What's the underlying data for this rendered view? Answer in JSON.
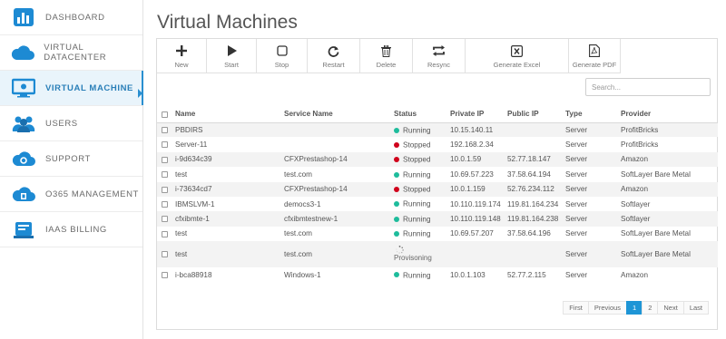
{
  "sidebar": {
    "items": [
      {
        "label": "DASHBOARD",
        "icon": "dashboard-icon"
      },
      {
        "label": "VIRTUAL DATACENTER",
        "icon": "cloud-icon"
      },
      {
        "label": "VIRTUAL MACHINE",
        "icon": "monitor-icon",
        "active": true
      },
      {
        "label": "USERS",
        "icon": "users-icon"
      },
      {
        "label": "SUPPORT",
        "icon": "support-cloud-icon"
      },
      {
        "label": "O365 MANAGEMENT",
        "icon": "office-cloud-icon"
      },
      {
        "label": "IAAS BILLING",
        "icon": "billing-icon"
      }
    ]
  },
  "page": {
    "title": "Virtual Machines"
  },
  "toolbar": [
    {
      "label": "New",
      "icon": "plus-icon"
    },
    {
      "label": "Start",
      "icon": "play-icon"
    },
    {
      "label": "Stop",
      "icon": "stop-icon"
    },
    {
      "label": "Restart",
      "icon": "restart-icon"
    },
    {
      "label": "Delete",
      "icon": "trash-icon"
    },
    {
      "label": "Resync",
      "icon": "resync-icon"
    },
    {
      "label": "Generate Excel",
      "icon": "excel-icon"
    },
    {
      "label": "Generate PDF",
      "icon": "pdf-icon"
    }
  ],
  "search": {
    "placeholder": "Search..."
  },
  "table": {
    "headers": [
      "Name",
      "Service Name",
      "Status",
      "Private IP",
      "Public IP",
      "Type",
      "Provider"
    ],
    "rows": [
      {
        "name": "PBDIRS",
        "service": "",
        "status": "Running",
        "private_ip": "10.15.140.11",
        "public_ip": "",
        "type": "Server",
        "provider": "ProfitBricks"
      },
      {
        "name": "Server-11",
        "service": "",
        "status": "Stopped",
        "private_ip": "192.168.2.34",
        "public_ip": "",
        "type": "Server",
        "provider": "ProfitBricks"
      },
      {
        "name": "i-9d634c39",
        "service": "CFXPrestashop-14",
        "status": "Stopped",
        "private_ip": "10.0.1.59",
        "public_ip": "52.77.18.147",
        "type": "Server",
        "provider": "Amazon"
      },
      {
        "name": "test",
        "service": "test.com",
        "status": "Running",
        "private_ip": "10.69.57.223",
        "public_ip": "37.58.64.194",
        "type": "Server",
        "provider": "SoftLayer Bare Metal"
      },
      {
        "name": "i-73634cd7",
        "service": "CFXPrestashop-14",
        "status": "Stopped",
        "private_ip": "10.0.1.159",
        "public_ip": "52.76.234.112",
        "type": "Server",
        "provider": "Amazon"
      },
      {
        "name": "IBMSLVM-1",
        "service": "democs3-1",
        "status": "Running",
        "private_ip": "10.110.119.174",
        "public_ip": "119.81.164.234",
        "type": "Server",
        "provider": "Softlayer"
      },
      {
        "name": "cfxibmte-1",
        "service": "cfxibmtestnew-1",
        "status": "Running",
        "private_ip": "10.110.119.148",
        "public_ip": "119.81.164.238",
        "type": "Server",
        "provider": "Softlayer"
      },
      {
        "name": "test",
        "service": "test.com",
        "status": "Running",
        "private_ip": "10.69.57.207",
        "public_ip": "37.58.64.196",
        "type": "Server",
        "provider": "SoftLayer Bare Metal"
      },
      {
        "name": "test",
        "service": "test.com",
        "status": "Provisoning",
        "private_ip": "",
        "public_ip": "",
        "type": "Server",
        "provider": "SoftLayer Bare Metal"
      },
      {
        "name": "i-bca88918",
        "service": "Windows-1",
        "status": "Running",
        "private_ip": "10.0.1.103",
        "public_ip": "52.77.2.115",
        "type": "Server",
        "provider": "Amazon"
      }
    ]
  },
  "pagination": [
    "First",
    "Previous",
    "1",
    "2",
    "Next",
    "Last"
  ],
  "pagination_active": "1",
  "colors": {
    "accent": "#1e95d6",
    "running": "#1ebc9c",
    "stopped": "#d0021b"
  }
}
